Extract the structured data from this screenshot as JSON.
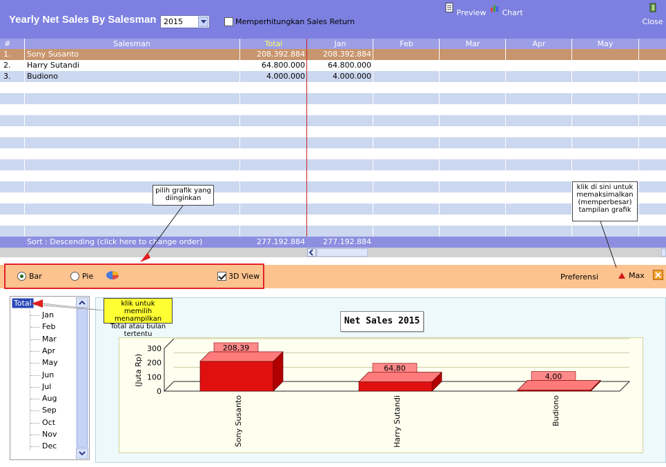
{
  "header": {
    "title": "Yearly Net Sales By Salesman",
    "year_value": "2015",
    "sales_return_label": "Memperhitungkan Sales Return",
    "preview_label": "Preview",
    "chart_label": "Chart",
    "close_label": "Close"
  },
  "grid": {
    "columns": [
      "#",
      "Salesman",
      "Total",
      "Jan",
      "Feb",
      "Mar",
      "Apr",
      "May"
    ],
    "rows": [
      {
        "no": "1.",
        "salesman": "Sony Susanto",
        "total": "208.392.884",
        "jan": "208.392.884"
      },
      {
        "no": "2.",
        "salesman": "Harry Sutandi",
        "total": "64.800.000",
        "jan": "64.800.000"
      },
      {
        "no": "3.",
        "salesman": "Budiono",
        "total": "4.000.000",
        "jan": "4.000.000"
      }
    ],
    "footer_sort": "Sort : Descending (click here to change order)",
    "footer_total": "277.192.884",
    "footer_jan": "277.192.884"
  },
  "options": {
    "bar_label": "Bar",
    "pie_label": "Pie",
    "view3d_label": "3D View",
    "preferensi_label": "Preferensi",
    "max_label": "Max"
  },
  "tree": {
    "root": "Total",
    "months": [
      "Jan",
      "Feb",
      "Mar",
      "Apr",
      "May",
      "Jun",
      "Jul",
      "Aug",
      "Sep",
      "Oct",
      "Nov",
      "Dec"
    ]
  },
  "callouts": {
    "grafik": "pilih grafik yang diinginkan",
    "maximize": "klik di sini untuk memaksimalkan (memperbesar) tampilan grafik",
    "tree": "klik untuk memilih menampilkan Total atau bulan tertentu"
  },
  "chart_data": {
    "type": "bar",
    "title": "Net Sales  2015",
    "ylabel": "(Juta Rp)",
    "categories": [
      "Sony Susanto",
      "Harry Sutandi",
      "Budiono"
    ],
    "values": [
      208.39,
      64.8,
      4.0
    ],
    "value_labels": [
      "208,39",
      "64,80",
      "4,00"
    ],
    "yticks": [
      "300",
      "200",
      "100",
      "0"
    ],
    "ylim": [
      0,
      300
    ],
    "colors": {
      "front": "#e01010",
      "top": "#ff7a7a",
      "side": "#b00000",
      "label_box": "#ff8a8a"
    }
  },
  "colors": {
    "header_bg": "#7d80e0",
    "row_selected": "#c8956e",
    "row_stripe": "#ccd7f0",
    "total_header_text": "#ffff66",
    "options_bar": "#fcc38f",
    "highlight_border": "#e0202a"
  }
}
